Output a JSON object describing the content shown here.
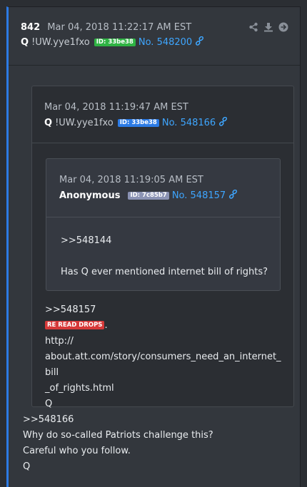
{
  "post": {
    "number": "842",
    "date": "Mar 04, 2018 11:22:17 AM EST",
    "name": "Q",
    "tripcode": "!UW.yye1fxo",
    "id_badge": "ID: 33be38",
    "post_no": "No. 548200",
    "lines": [
      "&gt;&gt;548166",
      "Why do so-called Patriots challenge this?",
      "Careful who you follow.",
      "Q"
    ]
  },
  "quote1": {
    "date": "Mar 04, 2018 11:19:47 AM EST",
    "name": "Q",
    "tripcode": "!UW.yye1fxo",
    "id_badge": "ID: 33be38",
    "post_no": "No. 548166",
    "ref": ">>548157",
    "tag": "RE READ DROPS",
    "tag_suffix": ".",
    "url_line1": "http://",
    "url_line2": "about.att.com/story/consumers_need_an_internet_bill",
    "url_line3": "_of_rights.html",
    "sign": "Q"
  },
  "quote2": {
    "date": "Mar 04, 2018 11:19:05 AM EST",
    "name": "Anonymous",
    "id_badge": "ID: 7c85b7",
    "post_no": "No. 548157",
    "ref": ">>548144",
    "text": "Has Q ever mentioned internet bill of rights?"
  },
  "colors": {
    "accent": "#2c7be5",
    "link": "#3ea6ff",
    "id_green": "#2fb344",
    "id_blue": "#2c7be5",
    "id_gray": "#8b93b4",
    "tag_red": "#d63939"
  },
  "icons": [
    "share-icon",
    "download-icon",
    "goto-arrow-icon",
    "link-chain-icon"
  ]
}
